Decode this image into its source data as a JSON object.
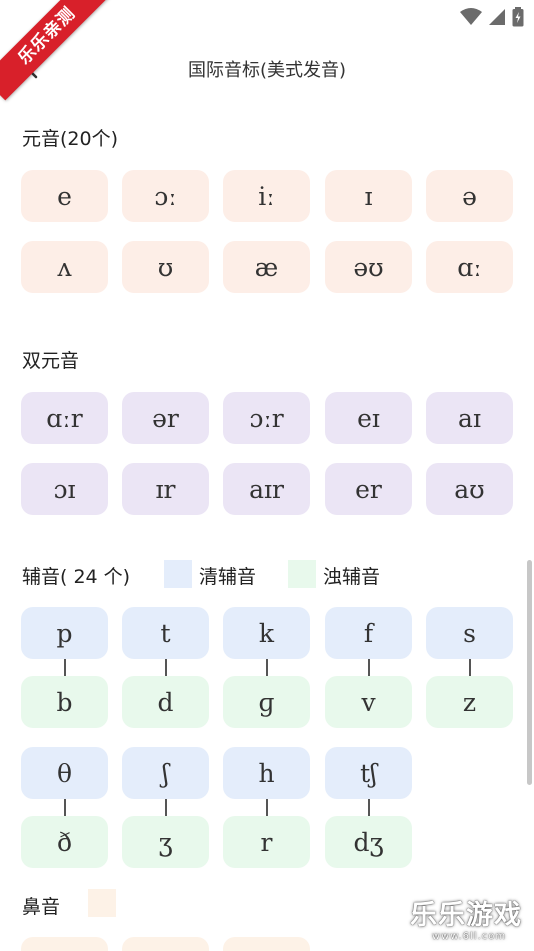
{
  "ribbon": {
    "text": "乐乐亲测"
  },
  "header": {
    "title": "国际音标(美式发音)"
  },
  "vowels": {
    "title": "元音(20个)",
    "items": [
      "e",
      "ɔː",
      "iː",
      "ɪ",
      "ə",
      "ʌ",
      "ʊ",
      "æ",
      "əʊ",
      "ɑː"
    ]
  },
  "diphthongs": {
    "title": "双元音",
    "items": [
      "ɑːr",
      "ər",
      "ɔːr",
      "eɪ",
      "aɪ",
      "ɔɪ",
      "ɪr",
      "aɪr",
      "er",
      "aʊ"
    ]
  },
  "consonants": {
    "title": "辅音( 24 个)",
    "legend_voiceless": "清辅音",
    "legend_voiced": "浊辅音",
    "voiceless": [
      "p",
      "t",
      "k",
      "f",
      "s",
      "θ",
      "ʃ",
      "h",
      "tʃ"
    ],
    "voiced": [
      "b",
      "d",
      "ɡ",
      "v",
      "z",
      "ð",
      "ʒ",
      "r",
      "dʒ"
    ]
  },
  "nasals": {
    "title": "鼻音"
  },
  "watermark": {
    "brand": "乐乐游戏",
    "url": "www.6ll.com"
  },
  "colors": {
    "vowel_bg": "#fdeee7",
    "diphthong_bg": "#ebe5f5",
    "voiceless_bg": "#e4edfb",
    "voiced_bg": "#e8f9ec",
    "nasal_bg": "#fdf2e7",
    "ribbon": "#d8202a"
  }
}
